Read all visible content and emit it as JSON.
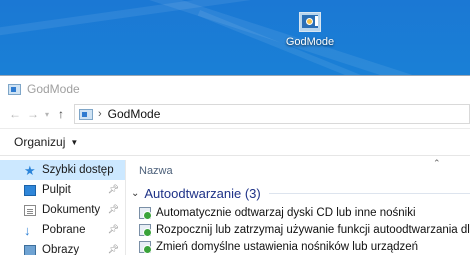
{
  "desktop": {
    "icon_label": "GodMode"
  },
  "window": {
    "title": "GodMode",
    "address": "GodMode",
    "toolbar": {
      "organize_label": "Organizuj"
    },
    "nav": {
      "items": [
        {
          "label": "Szybki dostęp",
          "icon": "star-icon",
          "selected": true
        },
        {
          "label": "Pulpit",
          "icon": "desktop-folder-icon",
          "pinned": true
        },
        {
          "label": "Dokumenty",
          "icon": "documents-folder-icon",
          "pinned": true
        },
        {
          "label": "Pobrane",
          "icon": "downloads-arrow-icon",
          "pinned": true
        },
        {
          "label": "Obrazy",
          "icon": "pictures-folder-icon",
          "pinned": true
        }
      ]
    },
    "content": {
      "column_name": "Nazwa",
      "group_title": "Autoodtwarzanie (3)",
      "items": [
        "Automatycznie odtwarzaj dyski CD lub inne nośniki",
        "Rozpocznij lub zatrzymaj używanie funkcji autoodtwarzania dla wszystkich no",
        "Zmień domyślne ustawienia nośników lub urządzeń"
      ]
    }
  },
  "colors": {
    "desktop_blue": "#1a80d6",
    "selection": "#cce8ff",
    "group_title": "#1e3287"
  }
}
